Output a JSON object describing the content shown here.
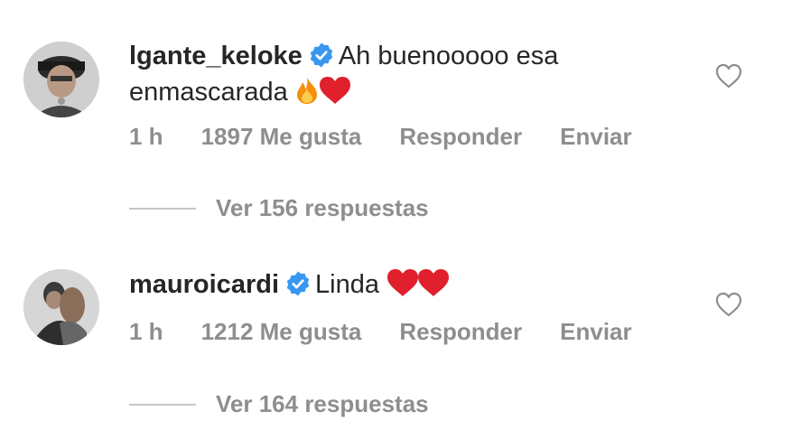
{
  "comments": [
    {
      "username": "lgante_keloke",
      "text": "Ah buenooooo esa enmascarada",
      "emojis": [
        "fire-emoji",
        "red-heart-emoji"
      ],
      "time": "1 h",
      "likes": "1897 Me gusta",
      "reply_label": "Responder",
      "send_label": "Enviar",
      "view_replies": "Ver 156 respuestas"
    },
    {
      "username": "mauroicardi",
      "text": "Linda",
      "emojis": [
        "red-heart-emoji",
        "red-heart-emoji"
      ],
      "time": "1 h",
      "likes": "1212 Me gusta",
      "reply_label": "Responder",
      "send_label": "Enviar",
      "view_replies": "Ver 164 respuestas"
    }
  ],
  "colors": {
    "text": "#262626",
    "meta": "#8e8e8e",
    "verified": "#3897f0",
    "heart": "#e0202c",
    "fire": "#f4900c"
  }
}
